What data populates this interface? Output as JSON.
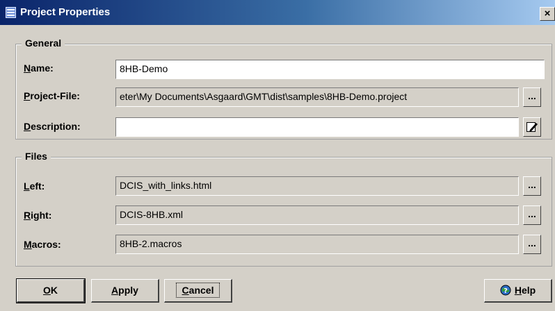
{
  "window": {
    "title": "Project Properties",
    "close_label": "×"
  },
  "general": {
    "title": "General",
    "name": {
      "label": "Name:",
      "mnemonic": "N",
      "rest": "ame:",
      "value": "8HB-Demo"
    },
    "project_file": {
      "label": "Project-File:",
      "mnemonic": "P",
      "rest": "roject-File:",
      "value": "eter\\My Documents\\Asgaard\\GMT\\dist\\samples\\8HB-Demo.project",
      "browse_label": "..."
    },
    "description": {
      "label": "Description:",
      "mnemonic": "D",
      "rest": "escription:",
      "value": ""
    }
  },
  "files": {
    "title": "Files",
    "left": {
      "label": "Left:",
      "mnemonic": "L",
      "rest": "eft:",
      "value": "DCIS_with_links.html",
      "browse_label": "..."
    },
    "right": {
      "label": "Right:",
      "mnemonic": "R",
      "rest": "ight:",
      "value": "DCIS-8HB.xml",
      "browse_label": "..."
    },
    "macros": {
      "label": "Macros:",
      "mnemonic": "M",
      "rest": "acros:",
      "value": "8HB-2.macros",
      "browse_label": "..."
    }
  },
  "buttons": {
    "ok": {
      "mnemonic": "O",
      "rest": "K"
    },
    "apply": {
      "mnemonic": "A",
      "rest": "pply"
    },
    "cancel": {
      "mnemonic": "C",
      "rest": "ancel"
    },
    "help": {
      "mnemonic": "H",
      "rest": "elp",
      "icon": "help-globe-icon"
    }
  }
}
